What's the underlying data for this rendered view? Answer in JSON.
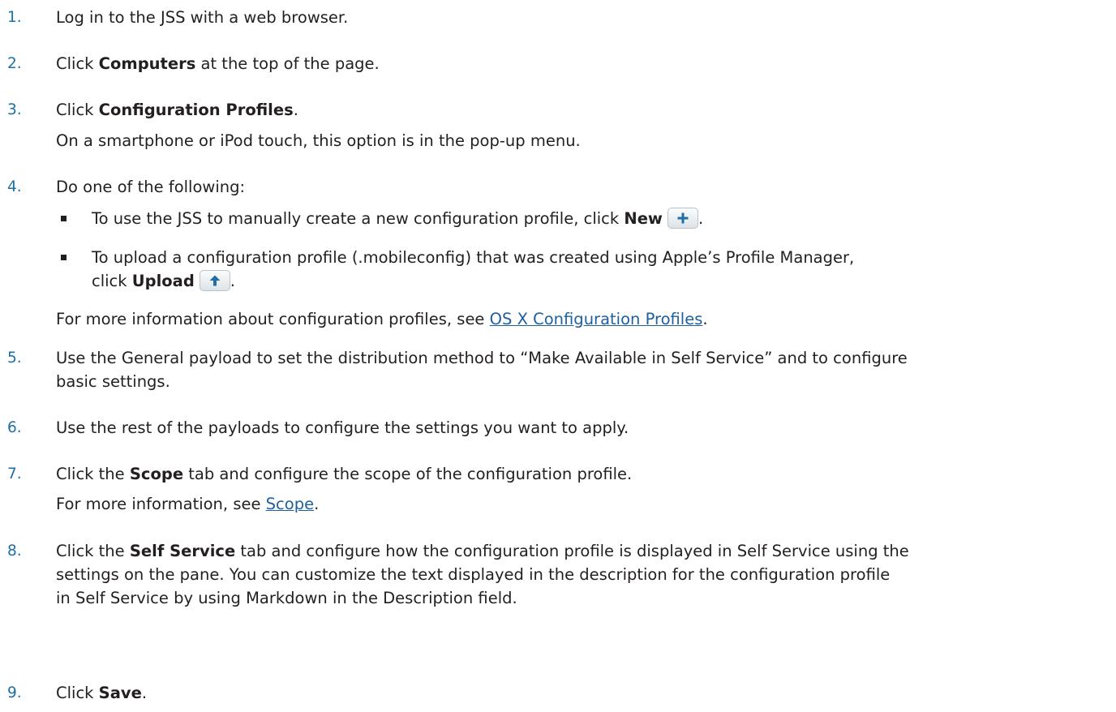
{
  "steps": [
    {
      "num": "1.",
      "pre": "Log in to the JSS with a web browser."
    },
    {
      "num": "2.",
      "pre": "Click ",
      "bold": "Computers",
      "post": " at the top of the page."
    },
    {
      "num": "3.",
      "pre": "Click ",
      "bold": "Configuration Profiles",
      "post": ".",
      "note": "On a smartphone or iPod touch, this option is in the pop-up menu."
    },
    {
      "num": "4.",
      "pre": "Do one of the following:",
      "bullets": [
        {
          "pre": "To use the JSS to manually create a new configuration profile, click ",
          "bold": "New",
          "button_icon": "plus-icon",
          "post": "."
        },
        {
          "line1": "To upload a configuration profile (.mobileconfig) that was created using Apple’s Profile Manager,",
          "pre": "click ",
          "bold": "Upload",
          "button_icon": "upload-arrow-icon",
          "post": "."
        }
      ],
      "note_pre": "For more information about configuration profiles, see ",
      "note_link": "OS X Configuration Profiles",
      "note_post": "."
    },
    {
      "num": "5.",
      "line1": "Use the General payload to set the distribution method to “Make Available in Self Service” and to configure",
      "line2": "basic settings."
    },
    {
      "num": "6.",
      "pre": "Use the rest of the payloads to configure the settings you want to apply."
    },
    {
      "num": "7.",
      "pre": "Click the ",
      "bold": "Scope",
      "post": " tab and configure the scope of the configuration profile.",
      "note_pre": "For more information, see ",
      "note_link": "Scope",
      "note_post": "."
    },
    {
      "num": "8.",
      "pre": "Click the ",
      "bold": "Self Service",
      "post": " tab and configure how the configuration profile is displayed in Self Service using the",
      "line2": "settings on the pane. You can customize the text displayed in the description for the configuration profile",
      "line3": "in Self Service by using Markdown in the Description field."
    },
    {
      "num": "9.",
      "pre": "Click ",
      "bold": "Save",
      "post": "."
    }
  ],
  "colors": {
    "step_number": "#1f6fa3",
    "body_text": "#231f20",
    "link": "#1f5fa0",
    "button_icon": "#1f6fa3"
  }
}
